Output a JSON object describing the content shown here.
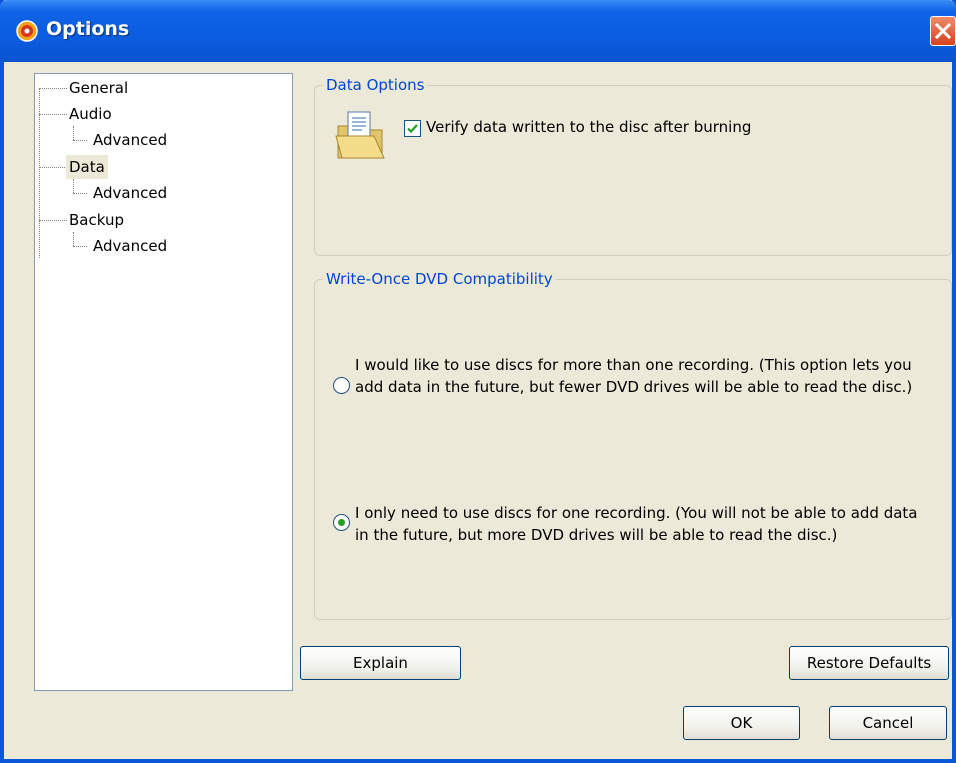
{
  "window": {
    "title": "Options"
  },
  "tree": {
    "items": [
      {
        "label": "General"
      },
      {
        "label": "Audio"
      },
      {
        "label": "Advanced"
      },
      {
        "label": "Data"
      },
      {
        "label": "Advanced"
      },
      {
        "label": "Backup"
      },
      {
        "label": "Advanced"
      }
    ],
    "selected": "Data"
  },
  "data_options": {
    "legend": "Data Options",
    "verify_label": "Verify data written to the disc after burning",
    "verify_checked": true
  },
  "compat": {
    "legend": "Write-Once DVD Compatibility",
    "option_multi": "I would like to use discs for more than one recording. (This option lets you add data in the future, but fewer DVD drives will be able to read the disc.)",
    "option_single": "I only need to use discs for one recording. (You will not be able to add data in the future, but more DVD drives will be able to read the disc.)",
    "selected": "single"
  },
  "buttons": {
    "explain": "Explain",
    "restore_defaults": "Restore Defaults",
    "ok": "OK",
    "cancel": "Cancel"
  },
  "colors": {
    "titlebar": "#0b5de0",
    "legend_text": "#0046d5",
    "close_button": "#d8421c",
    "radio_selected": "#21a121"
  }
}
